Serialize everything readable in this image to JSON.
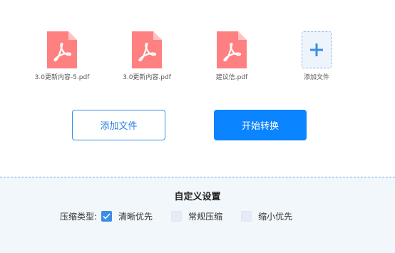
{
  "files": [
    {
      "name": "3.0更新内容-5.pdf",
      "icon": "pdf-file-icon"
    },
    {
      "name": "3.0更新内容.pdf",
      "icon": "pdf-file-icon"
    },
    {
      "name": "建议信.pdf",
      "icon": "pdf-file-icon"
    }
  ],
  "add_tile": {
    "label": "添加文件",
    "icon": "plus-icon"
  },
  "buttons": {
    "add_file": "添加文件",
    "start_convert": "开始转换"
  },
  "settings": {
    "title": "自定义设置",
    "compress_type_label": "压缩类型:",
    "options": [
      {
        "label": "清晰优先",
        "checked": true
      },
      {
        "label": "常规压缩",
        "checked": false
      },
      {
        "label": "缩小优先",
        "checked": false
      }
    ]
  },
  "colors": {
    "pdf_icon": "#ff7b7b",
    "accent": "#0a84ff",
    "panel_bg": "#f2f7fc"
  }
}
